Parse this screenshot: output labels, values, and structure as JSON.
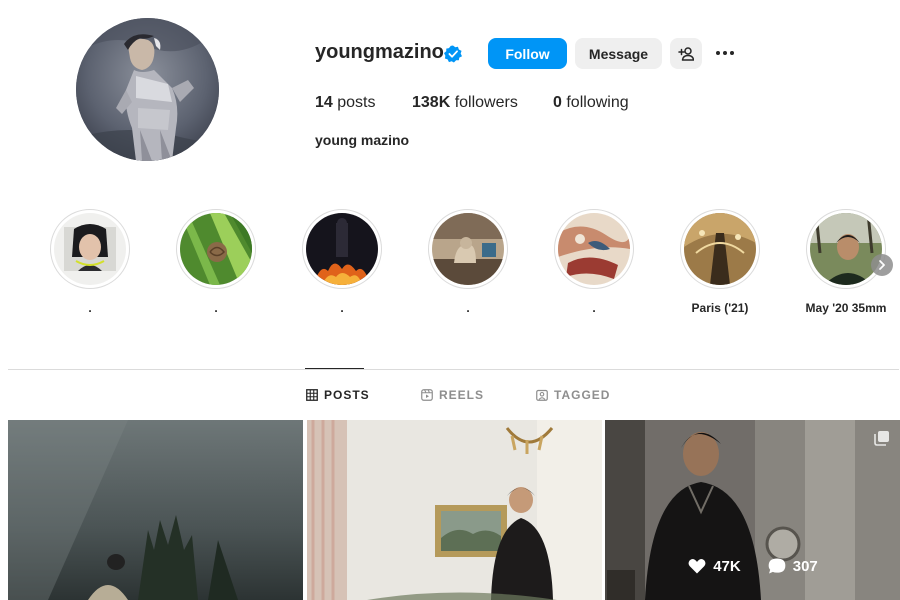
{
  "profile": {
    "username": "youngmazino",
    "full_name": "young mazino",
    "verified": true,
    "follow_label": "Follow",
    "message_label": "Message",
    "stats": {
      "posts_count": "14",
      "posts_label": "posts",
      "followers_count": "138K",
      "followers_label": "followers",
      "following_count": "0",
      "following_label": "following"
    }
  },
  "highlights": [
    {
      "label": "."
    },
    {
      "label": "."
    },
    {
      "label": "."
    },
    {
      "label": "."
    },
    {
      "label": "."
    },
    {
      "label": "Paris ('21)"
    },
    {
      "label": "May '20 35mm"
    }
  ],
  "tabs": {
    "posts": "POSTS",
    "reels": "REELS",
    "tagged": "TAGGED"
  },
  "posts": [
    {
      "likes": "",
      "comments": ""
    },
    {
      "likes": "",
      "comments": ""
    },
    {
      "likes": "47K",
      "comments": "307"
    }
  ],
  "colors": {
    "accent": "#0095f6",
    "verified": "#0095f6",
    "secondary_button": "#efefef",
    "text": "#262626",
    "muted": "#8e8e8e",
    "border": "#dbdbdb"
  }
}
